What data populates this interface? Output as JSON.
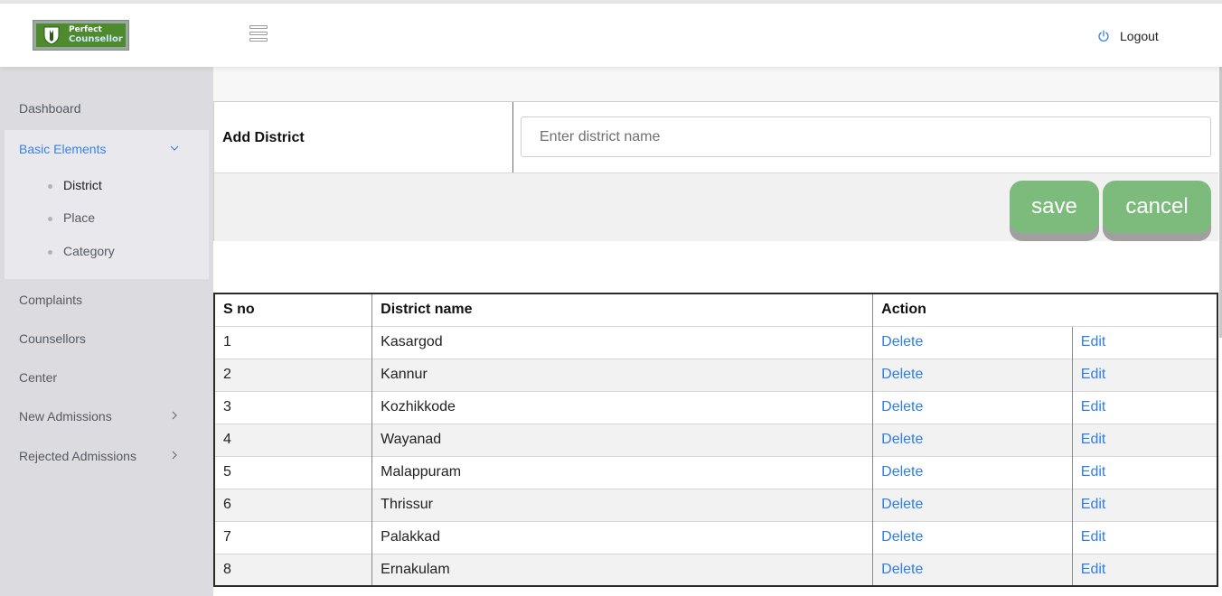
{
  "header": {
    "logo_line1": "Perfect",
    "logo_line2": "Counsellor",
    "logout_label": "Logout"
  },
  "sidebar": {
    "dashboard": "Dashboard",
    "basic_elements": "Basic Elements",
    "sub_items": [
      "District",
      "Place",
      "Category"
    ],
    "complaints": "Complaints",
    "counsellors": "Counsellors",
    "center": "Center",
    "new_admissions": "New Admissions",
    "rejected_admissions": "Rejected Admissions"
  },
  "form": {
    "label": "Add District",
    "placeholder": "Enter district name",
    "value": "",
    "save_label": "save",
    "cancel_label": "cancel"
  },
  "table": {
    "headers": {
      "sno": "S no",
      "name": "District name",
      "action": "Action"
    },
    "rows": [
      {
        "sno": "1",
        "name": "Kasargod",
        "delete": "Delete",
        "edit": "Edit"
      },
      {
        "sno": "2",
        "name": "Kannur",
        "delete": "Delete",
        "edit": "Edit"
      },
      {
        "sno": "3",
        "name": "Kozhikkode",
        "delete": "Delete",
        "edit": "Edit"
      },
      {
        "sno": "4",
        "name": "Wayanad",
        "delete": "Delete",
        "edit": "Edit"
      },
      {
        "sno": "5",
        "name": "Malappuram",
        "delete": "Delete",
        "edit": "Edit"
      },
      {
        "sno": "6",
        "name": "Thrissur",
        "delete": "Delete",
        "edit": "Edit"
      },
      {
        "sno": "7",
        "name": "Palakkad",
        "delete": "Delete",
        "edit": "Edit"
      },
      {
        "sno": "8",
        "name": "Ernakulam",
        "delete": "Delete",
        "edit": "Edit"
      }
    ]
  },
  "colors": {
    "accent": "#3b82e6",
    "button_green": "#7cbb7c",
    "sidebar_bg": "#dcdbe0"
  }
}
